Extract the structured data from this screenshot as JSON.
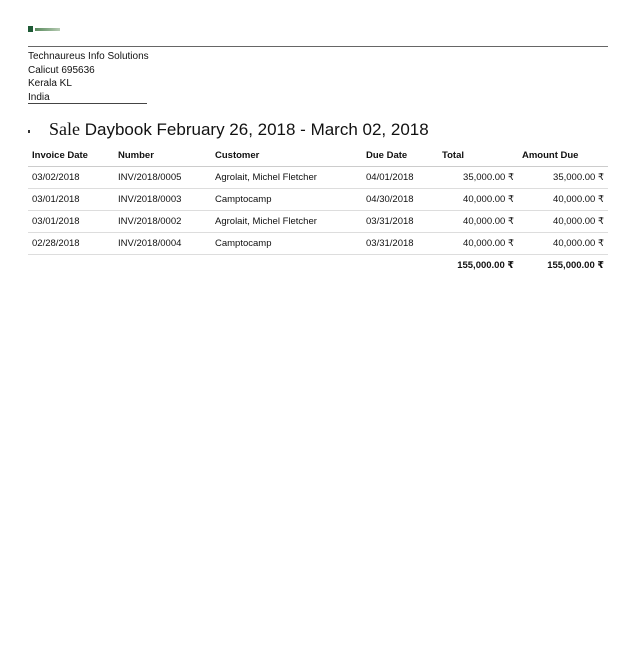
{
  "company": {
    "name": "Technaureus Info Solutions",
    "address_line1": "Calicut 695636",
    "address_line2": "Kerala KL",
    "country": "India"
  },
  "report": {
    "title_prefix": "Sale",
    "title_rest": " Daybook February 26, 2018 - March 02, 2018"
  },
  "table": {
    "headers": {
      "invoice_date": "Invoice Date",
      "number": "Number",
      "customer": "Customer",
      "due_date": "Due Date",
      "total": "Total",
      "amount_due": "Amount Due"
    },
    "rows": [
      {
        "invoice_date": "03/02/2018",
        "number": "INV/2018/0005",
        "customer": "Agrolait, Michel Fletcher",
        "due_date": "04/01/2018",
        "total": "35,000.00 ₹",
        "amount_due": "35,000.00 ₹"
      },
      {
        "invoice_date": "03/01/2018",
        "number": "INV/2018/0003",
        "customer": "Camptocamp",
        "due_date": "04/30/2018",
        "total": "40,000.00 ₹",
        "amount_due": "40,000.00 ₹"
      },
      {
        "invoice_date": "03/01/2018",
        "number": "INV/2018/0002",
        "customer": "Agrolait, Michel Fletcher",
        "due_date": "03/31/2018",
        "total": "40,000.00 ₹",
        "amount_due": "40,000.00 ₹"
      },
      {
        "invoice_date": "02/28/2018",
        "number": "INV/2018/0004",
        "customer": "Camptocamp",
        "due_date": "03/31/2018",
        "total": "40,000.00 ₹",
        "amount_due": "40,000.00 ₹"
      }
    ],
    "totals": {
      "total": "155,000.00 ₹",
      "amount_due": "155,000.00 ₹"
    }
  }
}
